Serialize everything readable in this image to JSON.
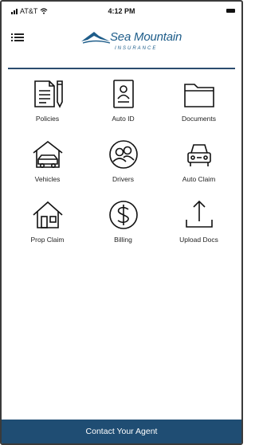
{
  "status_bar": {
    "carrier": "AT&T",
    "time": "4:12 PM"
  },
  "brand": {
    "name": "Sea Mountain",
    "subtitle": "INSURANCE",
    "color": "#1e5d8a"
  },
  "accent_color": "#1f4d73",
  "tiles": [
    {
      "label": "Policies",
      "icon": "document-pencil-icon"
    },
    {
      "label": "Auto ID",
      "icon": "id-card-icon"
    },
    {
      "label": "Documents",
      "icon": "folder-icon"
    },
    {
      "label": "Vehicles",
      "icon": "house-car-icon"
    },
    {
      "label": "Drivers",
      "icon": "drivers-icon"
    },
    {
      "label": "Auto Claim",
      "icon": "car-icon"
    },
    {
      "label": "Prop Claim",
      "icon": "home-icon"
    },
    {
      "label": "Billing",
      "icon": "dollar-icon"
    },
    {
      "label": "Upload Docs",
      "icon": "upload-icon"
    }
  ],
  "footer": {
    "label": "Contact Your Agent"
  }
}
